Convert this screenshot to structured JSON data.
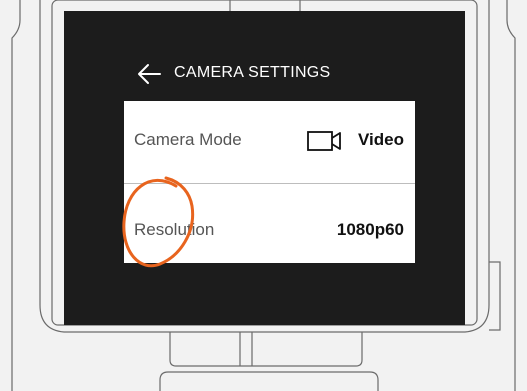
{
  "screen": {
    "title": "CAMERA SETTINGS",
    "back_icon": "arrow-left-icon",
    "rows": [
      {
        "label": "Camera Mode",
        "value": "Video",
        "icon": "video-camera-icon"
      },
      {
        "label": "Resolution",
        "value": "1080p60"
      }
    ]
  },
  "colors": {
    "bezel": "#1c1c1c",
    "screen": "#ffffff",
    "annotation": "#e8641e"
  }
}
